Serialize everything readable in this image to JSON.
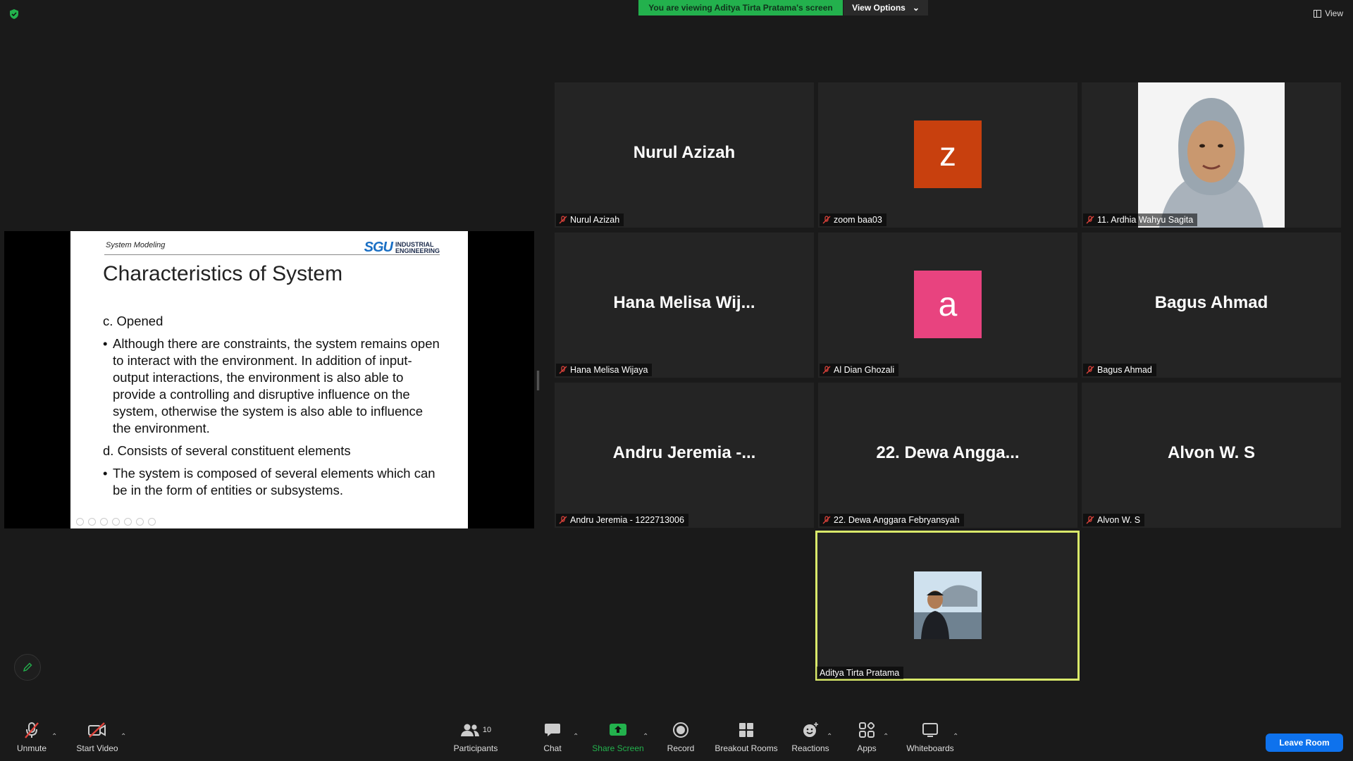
{
  "top": {
    "banner": "You are viewing Aditya Tirta Pratama's screen",
    "view_options": "View Options",
    "view": "View"
  },
  "slide": {
    "header": "System Modeling",
    "logo_mark": "SGU",
    "logo_line1": "INDUSTRIAL",
    "logo_line2": "ENGINEERING",
    "title": "Characteristics of System",
    "c_heading": "c. Opened",
    "c_bullet": "Although there are constraints, the system remains open to interact with the environment. In addition of input-output interactions, the environment is also able to provide a controlling and disruptive influence on the system, otherwise the system is also able to influence the environment.",
    "d_heading": "d. Consists of several constituent elements",
    "d_bullet": "The system is composed of several elements which can be in the form of entities or subsystems."
  },
  "tiles": [
    {
      "big": "Nurul Azizah",
      "label": "Nurul Azizah"
    },
    {
      "letter": "z",
      "color": "#c8400e",
      "label": "zoom baa03"
    },
    {
      "label": "11. Ardhia Wahyu Sagita"
    },
    {
      "big": "Hana Melisa Wij...",
      "label": "Hana Melisa Wijaya"
    },
    {
      "letter": "a",
      "color": "#e8437f",
      "label": "Al Dian Ghozali"
    },
    {
      "big": "Bagus Ahmad",
      "label": "Bagus Ahmad"
    },
    {
      "big": "Andru Jeremia -...",
      "label": "Andru Jeremia - 1222713006"
    },
    {
      "big": "22. Dewa Angga...",
      "label": "22. Dewa Anggara Febryansyah"
    },
    {
      "big": "Alvon W. S",
      "label": "Alvon W. S"
    },
    {
      "label": "Aditya Tirta Pratama"
    }
  ],
  "toolbar": {
    "unmute": "Unmute",
    "start_video": "Start Video",
    "participants": "Participants",
    "participants_count": "10",
    "chat": "Chat",
    "share_screen": "Share Screen",
    "record": "Record",
    "breakout_rooms": "Breakout Rooms",
    "reactions": "Reactions",
    "apps": "Apps",
    "whiteboards": "Whiteboards",
    "leave_room": "Leave Room"
  },
  "colors": {
    "banner": "#23b14d",
    "active_speaker": "#d9e96a",
    "leave": "#0e72ed",
    "share_green": "#23b14d",
    "mute_red": "#e0433b"
  }
}
